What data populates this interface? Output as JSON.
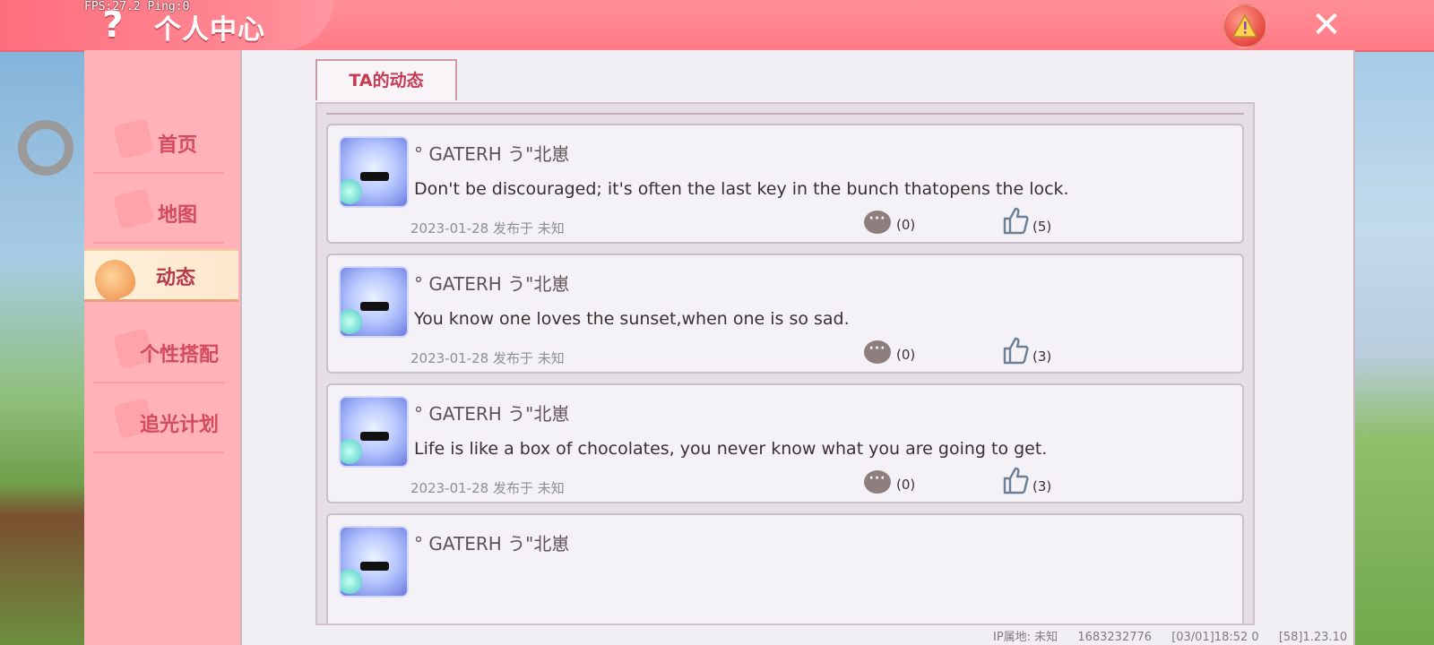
{
  "header": {
    "title": "个人中心",
    "fps": "FPS:27.2  Ping:0",
    "help_icon": "question-mark",
    "warning_icon": "warning-triangle",
    "close_icon": "close-x"
  },
  "sidebar": {
    "items": [
      {
        "label": "首页",
        "active": false
      },
      {
        "label": "地图",
        "active": false
      },
      {
        "label": "动态",
        "active": true
      },
      {
        "label": "个性搭配",
        "active": false
      },
      {
        "label": "追光计划",
        "active": false
      }
    ]
  },
  "main": {
    "tab_label": "TA的动态",
    "posts": [
      {
        "author": "°  GATERH う\"北崽",
        "content": "Don't be discouraged; it's often the last key in the bunch thatopens the lock.",
        "date": "2023-01-28  发布于 未知",
        "comments": "(0)",
        "likes": "(5)"
      },
      {
        "author": "°  GATERH う\"北崽",
        "content": "You know one loves the sunset,when one is so sad.",
        "date": "2023-01-28  发布于 未知",
        "comments": "(0)",
        "likes": "(3)"
      },
      {
        "author": "°  GATERH う\"北崽",
        "content": "Life is like a box of chocolates, you never know what you are going to get.",
        "date": "2023-01-28  发布于 未知",
        "comments": "(0)",
        "likes": "(3)"
      },
      {
        "author": "°  GATERH う\"北崽",
        "content": "",
        "date": "",
        "comments": "",
        "likes": ""
      }
    ]
  },
  "footer": {
    "ip": "IP属地: 未知",
    "uid": "1683232776",
    "time": "[03/01]18:52 0",
    "version": "[58]1.23.10"
  },
  "colors": {
    "header_pink": "#ff7b86",
    "sidebar_pink": "#ffb3b8",
    "accent_red": "#c63a54"
  }
}
